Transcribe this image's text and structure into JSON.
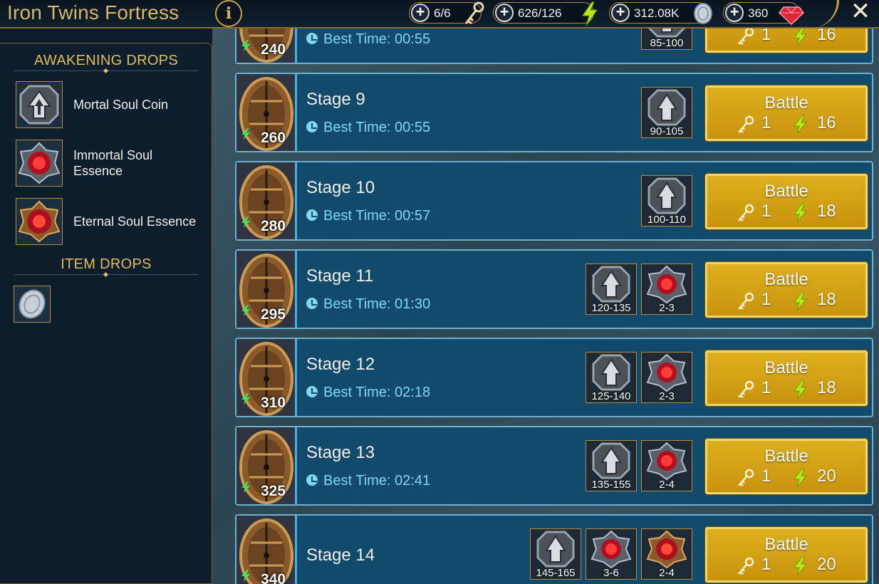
{
  "header": {
    "title": "Iron Twins Fortress",
    "info_label": "i",
    "close_label": "✕",
    "resources": [
      {
        "value": "6/6",
        "icon": "key-icon"
      },
      {
        "value": "626/126",
        "icon": "energy-icon"
      },
      {
        "value": "312.08K",
        "icon": "silver-icon"
      },
      {
        "value": "360",
        "icon": "gem-icon"
      }
    ]
  },
  "drops": {
    "awakening_heading": "AWAKENING DROPS",
    "items": [
      {
        "label": "Mortal Soul Coin"
      },
      {
        "label": "Immortal Soul Essence"
      },
      {
        "label": "Eternal Soul Essence"
      }
    ],
    "item_heading": "ITEM DROPS"
  },
  "stages": [
    {
      "name": "",
      "best_time": "Best Time: 00:55",
      "power": "240",
      "rewards": [
        "85-100"
      ],
      "keys": "1",
      "energy": "16"
    },
    {
      "name": "Stage 9",
      "best_time": "Best Time: 00:55",
      "power": "260",
      "rewards": [
        "90-105"
      ],
      "keys": "1",
      "energy": "16"
    },
    {
      "name": "Stage 10",
      "best_time": "Best Time: 00:57",
      "power": "280",
      "rewards": [
        "100-110"
      ],
      "keys": "1",
      "energy": "18"
    },
    {
      "name": "Stage 11",
      "best_time": "Best Time: 01:30",
      "power": "295",
      "rewards": [
        "120-135",
        "2-3"
      ],
      "keys": "1",
      "energy": "18"
    },
    {
      "name": "Stage 12",
      "best_time": "Best Time: 02:18",
      "power": "310",
      "rewards": [
        "125-140",
        "2-3"
      ],
      "keys": "1",
      "energy": "18"
    },
    {
      "name": "Stage 13",
      "best_time": "Best Time: 02:41",
      "power": "325",
      "rewards": [
        "135-155",
        "2-4"
      ],
      "keys": "1",
      "energy": "20"
    },
    {
      "name": "Stage 14",
      "best_time": "",
      "power": "340",
      "rewards": [
        "145-165",
        "3-6",
        "2-4"
      ],
      "keys": "1",
      "energy": "20"
    }
  ],
  "battle_label": "Battle",
  "colors": {
    "gold": "#d7b666",
    "panel": "#124a6b",
    "accent": "#7fd6ef",
    "button": "#d2a116"
  }
}
